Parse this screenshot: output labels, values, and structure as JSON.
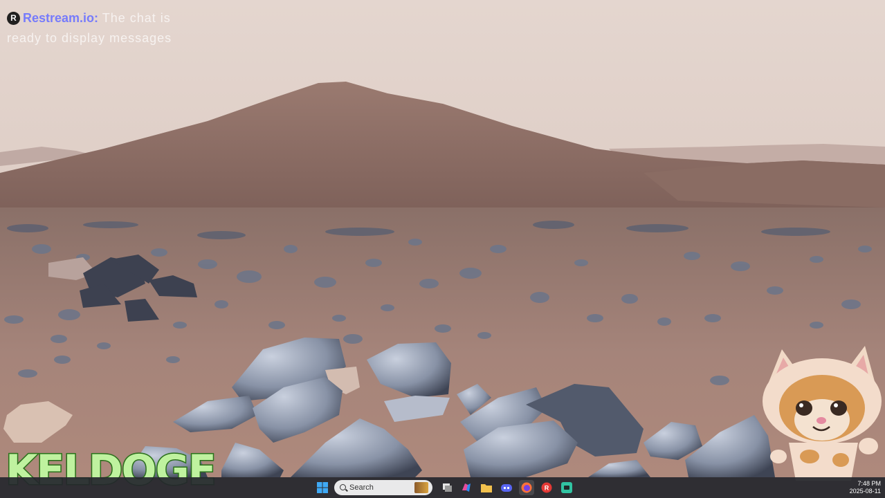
{
  "chat_overlay": {
    "brand": "Restream.io:",
    "message": " The chat is ready to display messages"
  },
  "watermark": {
    "text": "KELDOGE"
  },
  "taskbar": {
    "search_placeholder": "Search",
    "time": "7:48 PM",
    "date": "2025-08-11",
    "apps": [
      {
        "name": "windows-start",
        "icon": "windows-logo-icon"
      },
      {
        "name": "task-view",
        "icon": "task-view-icon"
      },
      {
        "name": "copilot",
        "icon": "copilot-icon"
      },
      {
        "name": "file-explorer",
        "icon": "folder-icon"
      },
      {
        "name": "discord",
        "icon": "discord-icon"
      },
      {
        "name": "firefox",
        "icon": "firefox-icon"
      },
      {
        "name": "restream",
        "icon": "restream-icon"
      },
      {
        "name": "streamlabs",
        "icon": "streamlabs-icon"
      }
    ]
  },
  "colors": {
    "sky": "#dccbc3",
    "hill": "#8c6c64",
    "ground": "#a07f75",
    "rocks": "#7c8698",
    "watermark_fill": "#bff29f",
    "watermark_stroke": "#2f7a1e",
    "brand": "#6d74ff",
    "taskbar": "#24262c"
  }
}
